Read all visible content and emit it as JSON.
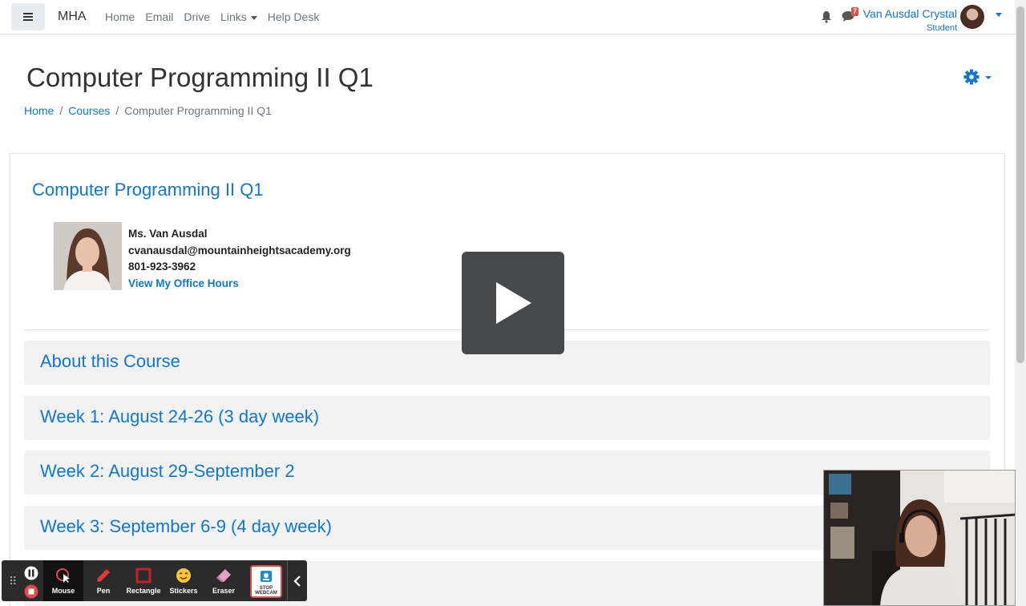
{
  "navbar": {
    "brand": "MHA",
    "links": [
      {
        "label": "Home"
      },
      {
        "label": "Email"
      },
      {
        "label": "Drive"
      },
      {
        "label": "Links"
      },
      {
        "label": "Help Desk"
      }
    ],
    "messages_count": "7",
    "user_name": "Van Ausdal Crystal",
    "user_role": "Student"
  },
  "page": {
    "title": "Computer Programming II Q1",
    "breadcrumb": [
      "Home",
      "Courses",
      "Computer Programming II Q1"
    ]
  },
  "course": {
    "name": "Computer Programming II Q1",
    "teacher_name": "Ms. Van Ausdal",
    "teacher_email": "cvanausdal@mountainheightsacademy.org",
    "teacher_phone": "801-923-3962",
    "office_hours_link": "View My Office Hours",
    "sections": [
      "About this Course",
      "Week 1: August 24-26 (3 day week)",
      "Week 2: August 29-September 2",
      "Week 3: September 6-9 (4 day week)"
    ]
  },
  "recorder": {
    "tools": [
      {
        "label": "Mouse",
        "icon": "cursor-icon"
      },
      {
        "label": "Pen",
        "icon": "pen-icon"
      },
      {
        "label": "Rectangle",
        "icon": "rectangle-icon"
      },
      {
        "label": "Stickers",
        "icon": "sticker-icon"
      },
      {
        "label": "Eraser",
        "icon": "eraser-icon"
      }
    ],
    "webcam_label_1": "STOP",
    "webcam_label_2": "WEBCAM"
  },
  "colors": {
    "link": "#1177d1",
    "section_bg": "#f2f2f2",
    "toolbar_bg": "#2b2b2b"
  }
}
